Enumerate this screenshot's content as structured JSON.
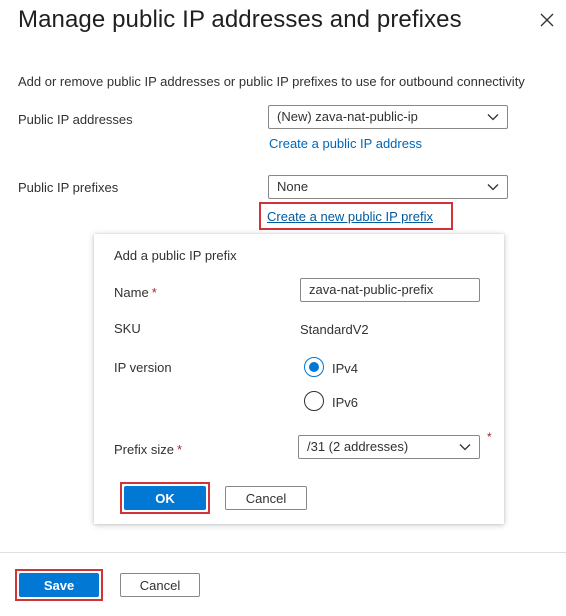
{
  "panel": {
    "title": "Manage public IP addresses and prefixes",
    "description": "Add or remove public IP addresses or public IP prefixes to use for outbound connectivity"
  },
  "public_ip_addresses": {
    "label": "Public IP addresses",
    "selected": "(New) zava-nat-public-ip",
    "create_link": "Create a public IP address"
  },
  "public_ip_prefixes": {
    "label": "Public IP prefixes",
    "selected": "None",
    "create_link": "Create a new public IP prefix"
  },
  "add_prefix": {
    "heading": "Add a public IP prefix",
    "name_label": "Name",
    "name_required": "*",
    "name_value": "zava-nat-public-prefix",
    "sku_label": "SKU",
    "sku_value": "StandardV2",
    "ip_version_label": "IP version",
    "ip_version_options": [
      "IPv4",
      "IPv6"
    ],
    "ip_version_selected": "IPv4",
    "prefix_size_label": "Prefix size",
    "prefix_size_required": "*",
    "prefix_size_value": "/31 (2 addresses)",
    "ok_label": "OK",
    "cancel_label": "Cancel"
  },
  "footer": {
    "save_label": "Save",
    "cancel_label": "Cancel"
  },
  "colors": {
    "accent": "#0078d4",
    "link": "#0067b8",
    "highlight": "#d13438",
    "required": "#a4262c"
  },
  "icons": {
    "close": "close-icon",
    "dropdown": "chevron-down-icon"
  }
}
